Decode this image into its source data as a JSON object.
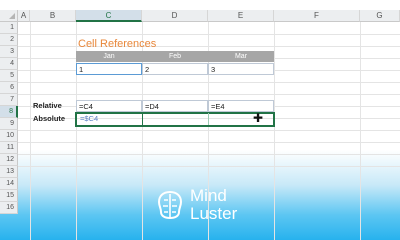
{
  "columns": [
    "A",
    "B",
    "C",
    "D",
    "E",
    "F",
    "G"
  ],
  "rows": [
    "1",
    "2",
    "3",
    "4",
    "5",
    "6",
    "7",
    "8",
    "9",
    "10",
    "11",
    "12",
    "13",
    "14",
    "15",
    "16"
  ],
  "title": "Cell References",
  "months": [
    "Jan",
    "Feb",
    "Mar"
  ],
  "values": [
    "1",
    "2",
    "3"
  ],
  "relative": {
    "label": "Relative",
    "c": "=C4",
    "d": "=D4",
    "e": "=E4"
  },
  "absolute": {
    "label": "Absolute",
    "c": "=$C4"
  },
  "brand": {
    "line1": "Mind",
    "line2": "Luster"
  }
}
